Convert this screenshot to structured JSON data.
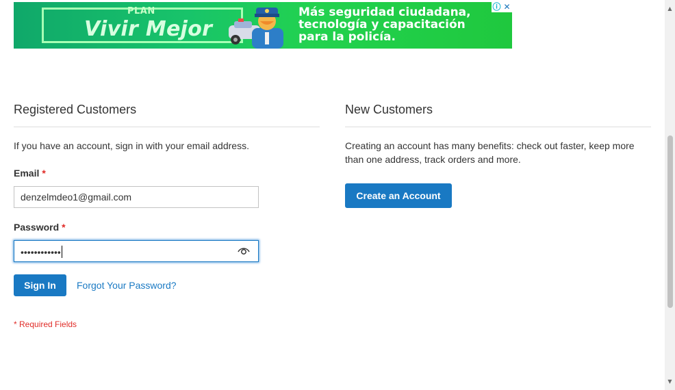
{
  "ad": {
    "plan_label": "PLAN",
    "plan_title": "Vivir Mejor",
    "message_lines": [
      "Más seguridad ciudadana,",
      "tecnología y capacitación",
      "para la policía."
    ],
    "info_icon": "info-icon",
    "close_icon": "close-icon"
  },
  "registered": {
    "title": "Registered Customers",
    "intro": "If you have an account, sign in with your email address.",
    "email_label": "Email",
    "email_value": "denzelmdeo1@gmail.com",
    "password_label": "Password",
    "password_masked": "••••••••••••",
    "show_password_icon": "eye-icon",
    "sign_in_label": "Sign In",
    "forgot_label": "Forgot Your Password?",
    "required_note": "* Required Fields",
    "required_star": "*"
  },
  "new_customers": {
    "title": "New Customers",
    "intro": "Creating an account has many benefits: check out faster, keep more than one address, track orders and more.",
    "create_label": "Create an Account"
  },
  "colors": {
    "primary": "#1979c3",
    "required": "#e02b27",
    "ad_green": "#22d24f"
  }
}
